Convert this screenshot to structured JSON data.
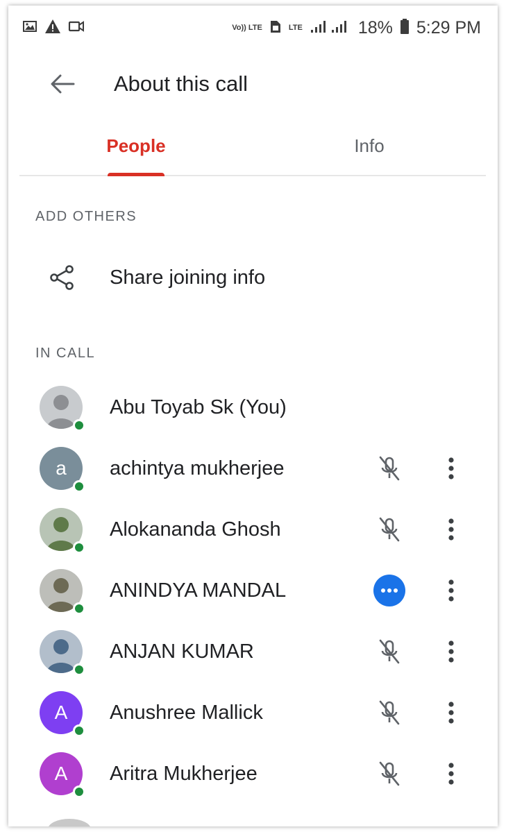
{
  "status_bar": {
    "battery": "18%",
    "time": "5:29 PM",
    "volte_label": "Vo)) LTE",
    "lte_label": "LTE"
  },
  "header": {
    "title": "About this call"
  },
  "tabs": [
    {
      "label": "People",
      "active": true
    },
    {
      "label": "Info",
      "active": false
    }
  ],
  "add_others": {
    "heading": "ADD OTHERS",
    "share_label": "Share joining info"
  },
  "in_call": {
    "heading": "IN CALL",
    "participants": [
      {
        "name": "Abu Toyab Sk (You)",
        "avatar": "photo",
        "avatar_color": "#8d8f93",
        "initial": "",
        "state": "self"
      },
      {
        "name": "achintya mukherjee",
        "avatar": "initial",
        "avatar_color": "#7a8e9a",
        "initial": "a",
        "state": "muted"
      },
      {
        "name": "Alokananda Ghosh",
        "avatar": "photo",
        "avatar_color": "#5f7a4a",
        "initial": "",
        "state": "muted"
      },
      {
        "name": "ANINDYA MANDAL",
        "avatar": "photo",
        "avatar_color": "#6d6a55",
        "initial": "",
        "state": "speaking"
      },
      {
        "name": "ANJAN KUMAR",
        "avatar": "photo",
        "avatar_color": "#4d6b8a",
        "initial": "",
        "state": "muted"
      },
      {
        "name": "Anushree Mallick",
        "avatar": "initial",
        "avatar_color": "#7e3ff2",
        "initial": "A",
        "state": "muted"
      },
      {
        "name": "Aritra Mukherjee",
        "avatar": "initial",
        "avatar_color": "#b03fcf",
        "initial": "A",
        "state": "muted"
      }
    ]
  },
  "colors": {
    "accent": "#d93025",
    "online": "#1e8e3e",
    "speaking": "#1a73e8"
  }
}
